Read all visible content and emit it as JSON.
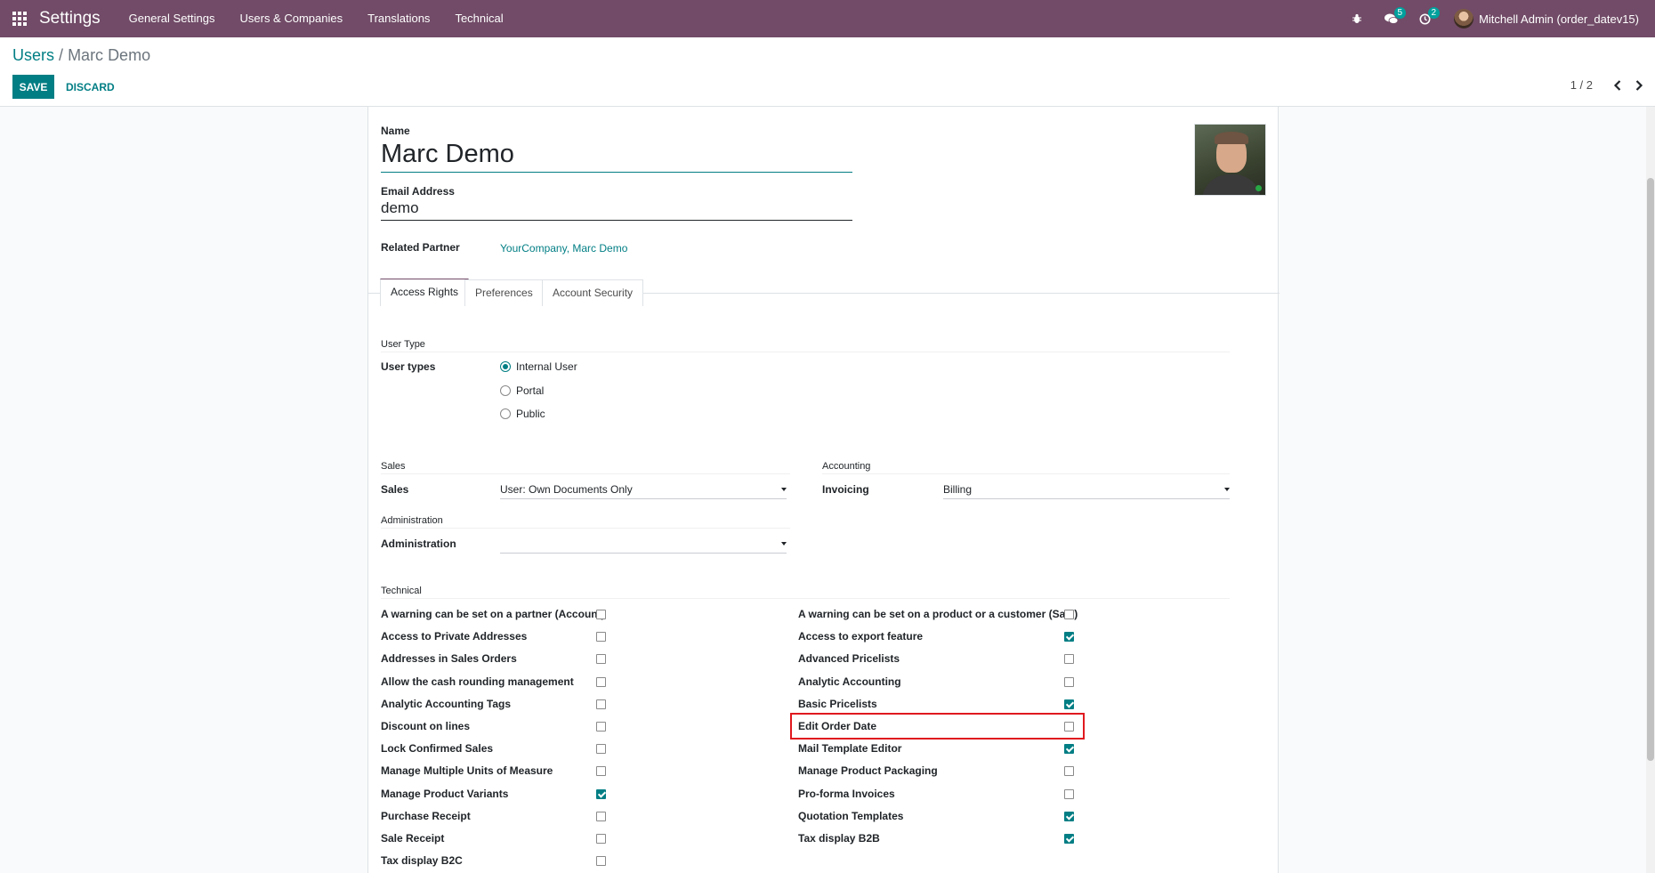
{
  "navbar": {
    "brand": "Settings",
    "menu": [
      "General Settings",
      "Users & Companies",
      "Translations",
      "Technical"
    ],
    "messages_count": "5",
    "activities_count": "2",
    "user": "Mitchell Admin (order_datev15)"
  },
  "control": {
    "breadcrumb_parent": "Users",
    "breadcrumb_sep": "/",
    "breadcrumb_current": "Marc Demo",
    "save_label": "SAVE",
    "discard_label": "DISCARD",
    "pager": "1 / 2"
  },
  "form": {
    "name_label": "Name",
    "name_value": "Marc Demo",
    "email_label": "Email Address",
    "email_value": "demo",
    "related_partner_label": "Related Partner",
    "related_partner_value": "YourCompany, Marc Demo"
  },
  "tabs": [
    "Access Rights",
    "Preferences",
    "Account Security"
  ],
  "access": {
    "user_type_title": "User Type",
    "user_types_label": "User types",
    "user_types": [
      "Internal User",
      "Portal",
      "Public"
    ],
    "sales_title": "Sales",
    "sales_label": "Sales",
    "sales_value": "User: Own Documents Only",
    "accounting_title": "Accounting",
    "invoicing_label": "Invoicing",
    "invoicing_value": "Billing",
    "administration_title": "Administration",
    "administration_label": "Administration",
    "administration_value": "",
    "technical_title": "Technical",
    "technical_left": [
      {
        "label": "A warning can be set on a partner (Account)",
        "checked": false
      },
      {
        "label": "Access to Private Addresses",
        "checked": false
      },
      {
        "label": "Addresses in Sales Orders",
        "checked": false
      },
      {
        "label": "Allow the cash rounding management",
        "checked": false
      },
      {
        "label": "Analytic Accounting Tags",
        "checked": false
      },
      {
        "label": "Discount on lines",
        "checked": false
      },
      {
        "label": "Lock Confirmed Sales",
        "checked": false
      },
      {
        "label": "Manage Multiple Units of Measure",
        "checked": false
      },
      {
        "label": "Manage Product Variants",
        "checked": true
      },
      {
        "label": "Purchase Receipt",
        "checked": false
      },
      {
        "label": "Sale Receipt",
        "checked": false
      },
      {
        "label": "Tax display B2C",
        "checked": false
      }
    ],
    "technical_right": [
      {
        "label": "A warning can be set on a product or a customer (Sale)",
        "checked": false
      },
      {
        "label": "Access to export feature",
        "checked": true
      },
      {
        "label": "Advanced Pricelists",
        "checked": false
      },
      {
        "label": "Analytic Accounting",
        "checked": false
      },
      {
        "label": "Basic Pricelists",
        "checked": true
      },
      {
        "label": "Edit Order Date",
        "checked": false
      },
      {
        "label": "Mail Template Editor",
        "checked": true
      },
      {
        "label": "Manage Product Packaging",
        "checked": false
      },
      {
        "label": "Pro-forma Invoices",
        "checked": false
      },
      {
        "label": "Quotation Templates",
        "checked": true
      },
      {
        "label": "Tax display B2B",
        "checked": true
      }
    ]
  },
  "colors": {
    "navbar": "#714b67",
    "primary": "#017e84",
    "highlight": "#e0191f"
  }
}
